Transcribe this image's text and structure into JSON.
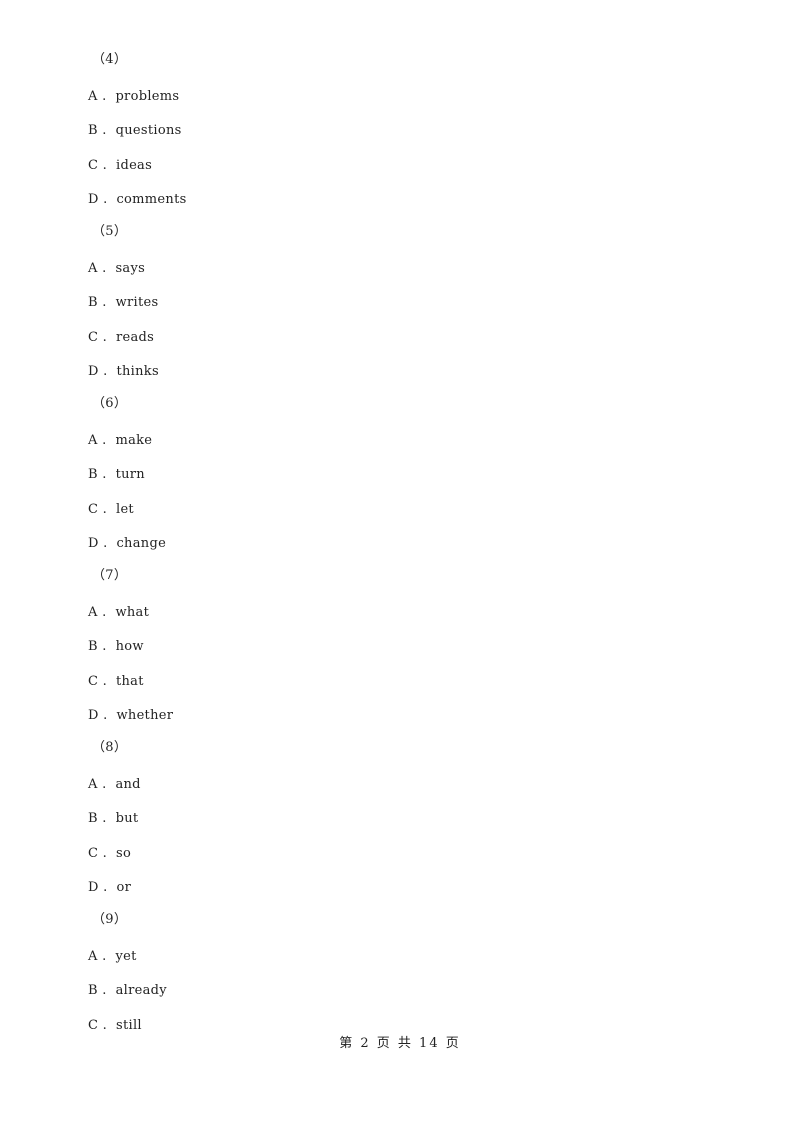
{
  "questions": [
    {
      "number": "（4）",
      "options": [
        {
          "letter": "A",
          "text": "problems"
        },
        {
          "letter": "B",
          "text": "questions"
        },
        {
          "letter": "C",
          "text": "ideas"
        },
        {
          "letter": "D",
          "text": "comments"
        }
      ]
    },
    {
      "number": "（5）",
      "options": [
        {
          "letter": "A",
          "text": "says"
        },
        {
          "letter": "B",
          "text": "writes"
        },
        {
          "letter": "C",
          "text": "reads"
        },
        {
          "letter": "D",
          "text": "thinks"
        }
      ]
    },
    {
      "number": "（6）",
      "options": [
        {
          "letter": "A",
          "text": "make"
        },
        {
          "letter": "B",
          "text": "turn"
        },
        {
          "letter": "C",
          "text": "let"
        },
        {
          "letter": "D",
          "text": "change"
        }
      ]
    },
    {
      "number": "（7）",
      "options": [
        {
          "letter": "A",
          "text": "what"
        },
        {
          "letter": "B",
          "text": "how"
        },
        {
          "letter": "C",
          "text": "that"
        },
        {
          "letter": "D",
          "text": "whether"
        }
      ]
    },
    {
      "number": "（8）",
      "options": [
        {
          "letter": "A",
          "text": "and"
        },
        {
          "letter": "B",
          "text": "but"
        },
        {
          "letter": "C",
          "text": "so"
        },
        {
          "letter": "D",
          "text": "or"
        }
      ]
    },
    {
      "number": "（9）",
      "options": [
        {
          "letter": "A",
          "text": "yet"
        },
        {
          "letter": "B",
          "text": "already"
        },
        {
          "letter": "C",
          "text": "still"
        }
      ]
    }
  ],
  "footer": {
    "page_label": "第 2 页 共 14 页"
  }
}
